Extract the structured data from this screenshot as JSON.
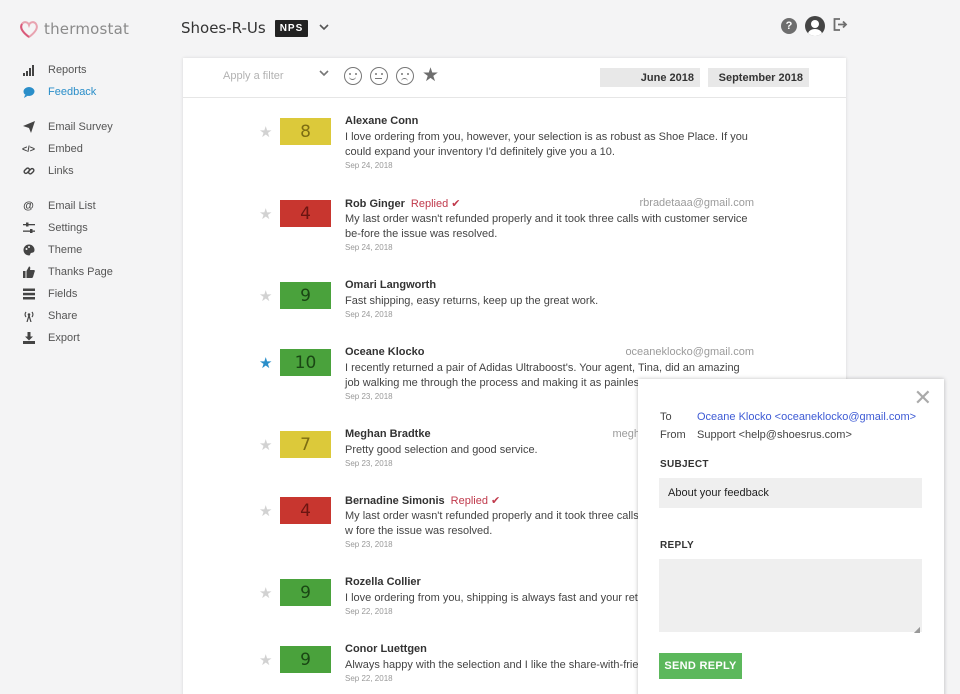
{
  "app": {
    "logo_text": "thermostat"
  },
  "sidebar": {
    "items": [
      {
        "label": "Reports",
        "icon": "bar-chart-icon"
      },
      {
        "label": "Feedback",
        "icon": "chat-bubble-icon",
        "active": true
      },
      {
        "label": "Email Survey",
        "icon": "paper-plane-icon"
      },
      {
        "label": "Embed",
        "icon": "code-icon"
      },
      {
        "label": "Links",
        "icon": "link-icon"
      },
      {
        "label": "Email List",
        "icon": "at-sign-icon"
      },
      {
        "label": "Settings",
        "icon": "sliders-icon"
      },
      {
        "label": "Theme",
        "icon": "palette-icon"
      },
      {
        "label": "Thanks Page",
        "icon": "thumbs-up-icon"
      },
      {
        "label": "Fields",
        "icon": "list-icon"
      },
      {
        "label": "Share",
        "icon": "broadcast-icon"
      },
      {
        "label": "Export",
        "icon": "download-icon"
      }
    ]
  },
  "header": {
    "project": "Shoes-R-Us",
    "badge": "NPS"
  },
  "filters": {
    "placeholder": "Apply a filter",
    "date_from": "June 2018",
    "date_to": "September 2018"
  },
  "colors": {
    "promoter": "#4aa23c",
    "passive": "#dcc93a",
    "detractor": "#c8362f",
    "accent": "#2a8ec9"
  },
  "feedback": [
    {
      "starred": false,
      "score": "8",
      "score_type": "passive",
      "name": "Alexane Conn",
      "replied": "",
      "email": "",
      "comment": "I love ordering from you, however, your selection is as robust as Shoe Place. If you could expand your inventory I'd definitely give you a 10.",
      "date": "Sep 24, 2018"
    },
    {
      "starred": false,
      "score": "4",
      "score_type": "detractor",
      "name": "Rob Ginger",
      "replied": "Replied ✔",
      "email": "rbradetaaa@gmail.com",
      "comment": "My last order wasn't refunded properly and it took three calls with customer service be-fore the issue was resolved.",
      "date": "Sep 24, 2018"
    },
    {
      "starred": false,
      "score": "9",
      "score_type": "promoter",
      "name": "Omari Langworth",
      "replied": "",
      "email": "",
      "comment": "Fast shipping, easy returns, keep up the great work.",
      "date": "Sep 24, 2018"
    },
    {
      "starred": true,
      "score": "10",
      "score_type": "promoter",
      "name": "Oceane Klocko",
      "replied": "",
      "email": "oceaneklocko@gmail.com",
      "comment": "I recently returned a pair of Adidas Ultraboost's. Your agent, Tina, did an amazing job walking me through the process and making it as painless as po",
      "date": "Sep 23, 2018"
    },
    {
      "starred": false,
      "score": "7",
      "score_type": "passive",
      "name": "Meghan Bradtke",
      "replied": "",
      "email": "megh",
      "comment": "Pretty good selection and good service.",
      "date": "Sep 23, 2018"
    },
    {
      "starred": false,
      "score": "4",
      "score_type": "detractor",
      "name": "Bernadine Simonis",
      "replied": "Replied ✔",
      "email": "",
      "comment": "My last order wasn't refunded properly and it took three calls w fore the issue was resolved.",
      "date": "Sep 23, 2018"
    },
    {
      "starred": false,
      "score": "9",
      "score_type": "promoter",
      "name": "Rozella Collier",
      "replied": "",
      "email": "",
      "comment": "I love ordering from you, shipping is always fast and your return",
      "date": "Sep 22, 2018"
    },
    {
      "starred": false,
      "score": "9",
      "score_type": "promoter",
      "name": "Conor Luettgen",
      "replied": "",
      "email": "",
      "comment": "Always happy with the selection and I like the share-with-frienc",
      "date": "Sep 22, 2018"
    }
  ],
  "reply_modal": {
    "to_label": "To",
    "to_value": "Oceane Klocko <oceaneklocko@gmail.com>",
    "from_label": "From",
    "from_value": "Support <help@shoesrus.com>",
    "subject_label": "SUBJECT",
    "subject_value": "About your feedback",
    "reply_label": "REPLY",
    "reply_value": "",
    "send_label": "SEND REPLY"
  }
}
